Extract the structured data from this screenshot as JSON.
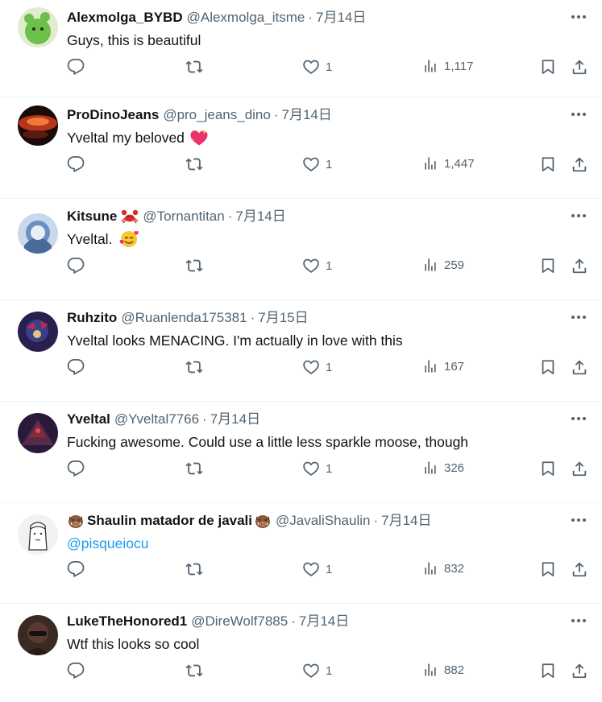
{
  "tweets": [
    {
      "name": "Alexmolga_BYBD",
      "handle": "@Alexmolga_itsme",
      "date": "7月14日",
      "text": "Guys, this is beautiful",
      "likes": "1",
      "views": "1,117",
      "avatar_color": "#6bbf4a"
    },
    {
      "name": "ProDinoJeans",
      "handle": "@pro_jeans_dino",
      "date": "7月14日",
      "text": "Yveltal my beloved",
      "text_emoji": "sparkling-heart",
      "likes": "1",
      "views": "1,447",
      "avatar_color": "#b5341c"
    },
    {
      "name": "Kitsune",
      "name_emoji": "crab",
      "handle": "@Tornantitan",
      "date": "7月14日",
      "text": "Yveltal.",
      "text_emoji": "smiling-face-with-hearts",
      "likes": "1",
      "views": "259",
      "avatar_color": "#6a8fc0"
    },
    {
      "name": "Ruhzito",
      "handle": "@Ruanlenda175381",
      "date": "7月15日",
      "text": "Yveltal looks MENACING. I'm actually in love with this",
      "likes": "1",
      "views": "167",
      "avatar_color": "#3a3f8a"
    },
    {
      "name": "Yveltal",
      "handle": "@Yveltal7766",
      "date": "7月14日",
      "text": "Fucking awesome. Could use a little less sparkle moose, though",
      "likes": "1",
      "views": "326",
      "avatar_color": "#5a2a4a"
    },
    {
      "name": "Shaulin matador de javali",
      "name_emoji": "boar",
      "handle": "@JavaliShaulin",
      "date": "7月14日",
      "mention": "@pisqueiocu",
      "likes": "1",
      "views": "832",
      "avatar_color": "#e8e8e8"
    },
    {
      "name": "LukeTheHonored1",
      "handle": "@DireWolf7885",
      "date": "7月14日",
      "text": "Wtf this looks so cool",
      "likes": "1",
      "views": "882",
      "avatar_color": "#5a3a30"
    }
  ],
  "icons": {
    "more": "more-icon",
    "reply": "reply-icon",
    "retweet": "retweet-icon",
    "like": "heart-icon",
    "views": "views-icon",
    "bookmark": "bookmark-icon",
    "share": "share-icon"
  },
  "colors": {
    "text": "#0f1419",
    "secondary": "#536471",
    "link": "#1d9bf0",
    "divider": "#eff3f4"
  }
}
